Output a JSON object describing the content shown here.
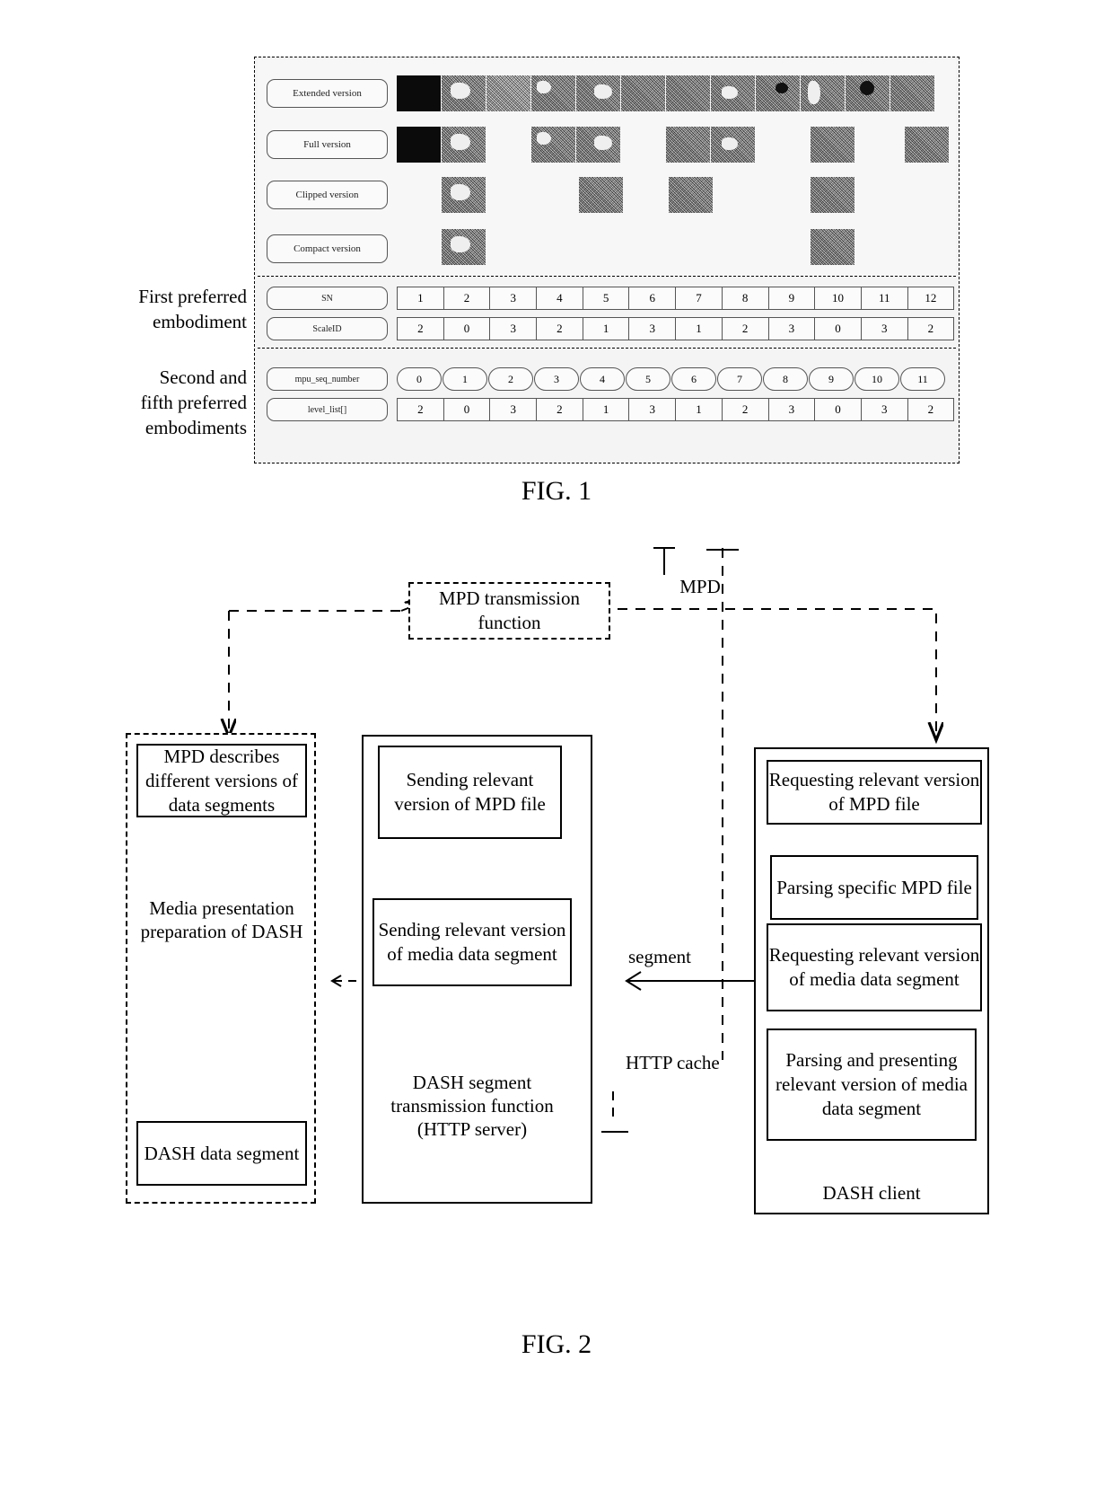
{
  "figure1": {
    "caption": "FIG. 1",
    "version_rows": [
      {
        "label": "Extended version"
      },
      {
        "label": "Full version"
      },
      {
        "label": "Clipped version"
      },
      {
        "label": "Compact version"
      }
    ],
    "side_notes": [
      "First preferred\nembodiment",
      "Second and\nfifth preferred\nembodiments"
    ],
    "table_first": {
      "rows": [
        {
          "label": "SN",
          "values": [
            "1",
            "2",
            "3",
            "4",
            "5",
            "6",
            "7",
            "8",
            "9",
            "10",
            "11",
            "12"
          ]
        },
        {
          "label": "ScaleID",
          "values": [
            "2",
            "0",
            "3",
            "2",
            "1",
            "3",
            "1",
            "2",
            "3",
            "0",
            "3",
            "2"
          ]
        }
      ]
    },
    "table_second": {
      "rows": [
        {
          "label": "mpu_seq_number",
          "values": [
            "0",
            "1",
            "2",
            "3",
            "4",
            "5",
            "6",
            "7",
            "8",
            "9",
            "10",
            "11"
          ]
        },
        {
          "label": "level_list[]",
          "values": [
            "2",
            "0",
            "3",
            "2",
            "1",
            "3",
            "1",
            "2",
            "3",
            "0",
            "3",
            "2"
          ]
        }
      ]
    }
  },
  "figure2": {
    "caption": "FIG. 2",
    "mpd_transmission": "MPD transmission function",
    "mpd_label": "MPD",
    "left_group": {
      "top_box": "MPD describes different versions of data segments",
      "middle_text": "Media presentation preparation of DASH",
      "bottom_box": "DASH data segment"
    },
    "server_group": {
      "box1": "Sending relevant version of MPD file",
      "box2": "Sending relevant version of media data segment",
      "title": "DASH segment transmission function (HTTP server)"
    },
    "client_group": {
      "box1": "Requesting relevant version of MPD file",
      "box2": "Parsing specific MPD file",
      "box3": "Requesting relevant version of media data segment",
      "box4": "Parsing and presenting relevant version of media data segment",
      "title": "DASH client"
    },
    "segment_label": "segment",
    "http_cache_label": "HTTP cache"
  }
}
